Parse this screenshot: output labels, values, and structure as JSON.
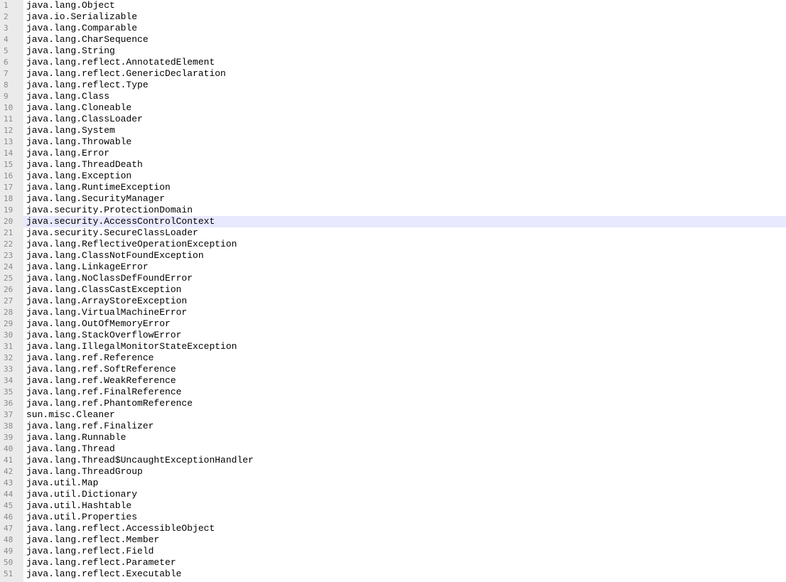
{
  "editor": {
    "current_line": 20,
    "lines": [
      "java.lang.Object",
      "java.io.Serializable",
      "java.lang.Comparable",
      "java.lang.CharSequence",
      "java.lang.String",
      "java.lang.reflect.AnnotatedElement",
      "java.lang.reflect.GenericDeclaration",
      "java.lang.reflect.Type",
      "java.lang.Class",
      "java.lang.Cloneable",
      "java.lang.ClassLoader",
      "java.lang.System",
      "java.lang.Throwable",
      "java.lang.Error",
      "java.lang.ThreadDeath",
      "java.lang.Exception",
      "java.lang.RuntimeException",
      "java.lang.SecurityManager",
      "java.security.ProtectionDomain",
      "java.security.AccessControlContext",
      "java.security.SecureClassLoader",
      "java.lang.ReflectiveOperationException",
      "java.lang.ClassNotFoundException",
      "java.lang.LinkageError",
      "java.lang.NoClassDefFoundError",
      "java.lang.ClassCastException",
      "java.lang.ArrayStoreException",
      "java.lang.VirtualMachineError",
      "java.lang.OutOfMemoryError",
      "java.lang.StackOverflowError",
      "java.lang.IllegalMonitorStateException",
      "java.lang.ref.Reference",
      "java.lang.ref.SoftReference",
      "java.lang.ref.WeakReference",
      "java.lang.ref.FinalReference",
      "java.lang.ref.PhantomReference",
      "sun.misc.Cleaner",
      "java.lang.ref.Finalizer",
      "java.lang.Runnable",
      "java.lang.Thread",
      "java.lang.Thread$UncaughtExceptionHandler",
      "java.lang.ThreadGroup",
      "java.util.Map",
      "java.util.Dictionary",
      "java.util.Hashtable",
      "java.util.Properties",
      "java.lang.reflect.AccessibleObject",
      "java.lang.reflect.Member",
      "java.lang.reflect.Field",
      "java.lang.reflect.Parameter",
      "java.lang.reflect.Executable"
    ]
  }
}
